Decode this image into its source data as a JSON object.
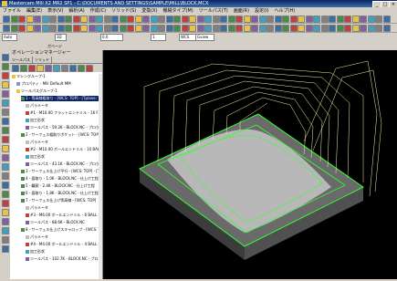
{
  "window": {
    "title": "Mastercam Mill X2 MR2 SP1 - C:\\DOCUMENTS AND SETTINGS\\SAMPLE\\MILL\\BLOCK.MCX"
  },
  "menu": [
    "ファイル",
    "編集(E)",
    "表示(V)",
    "解析(A)",
    "作成(C)",
    "ソリッド(S)",
    "変換(X)",
    "機械タイプ(M)",
    "ツールパス(T)",
    "画面(R)",
    "設定(I)",
    "ヘルプ(H)"
  ],
  "toolbar": {
    "zoom_value": "Auto",
    "plane_value": "3D",
    "z_value": "0.0",
    "level_value": "1",
    "wcs_label": "WCS",
    "grid_label": "Gview"
  },
  "ruler": {
    "label": "ガベージ"
  },
  "panel": {
    "title": "オペレーションマネージャー",
    "tabs": [
      "ツールパス",
      "ソリッド"
    ],
    "tree": [
      {
        "indent": 0,
        "text": "マシングループ-1",
        "icon": "folder"
      },
      {
        "indent": 1,
        "text": "プロパティ - Mill Default MM",
        "icon": "props"
      },
      {
        "indent": 1,
        "text": "ツールパスグループ-1",
        "icon": "folder"
      },
      {
        "indent": 2,
        "text": "1 - 等高線粗取り - [WCS: TOP] - [Tplane: TOP]",
        "icon": "op",
        "selected": true
      },
      {
        "indent": 3,
        "text": "パラメータ",
        "icon": "params"
      },
      {
        "indent": 3,
        "text": "#1 - M16.00 フラットエンドミル - 16 FLAT ENDMILL",
        "icon": "tool"
      },
      {
        "indent": 3,
        "text": "加工形状",
        "icon": "geom"
      },
      {
        "indent": 3,
        "text": "ツールパス - 59.2K - BLOCK.NC - プログラム番号 0",
        "icon": "path"
      },
      {
        "indent": 2,
        "text": "2 - サーフェス粗取りポケット - [WCS: TOP]",
        "icon": "op"
      },
      {
        "indent": 3,
        "text": "パラメータ",
        "icon": "params"
      },
      {
        "indent": 3,
        "text": "#2 - M10.00 ボールエンドミル - 10 BALL ENDMILL",
        "icon": "tool"
      },
      {
        "indent": 3,
        "text": "加工形状",
        "icon": "geom"
      },
      {
        "indent": 3,
        "text": "ツールパス - 43.1K - BLOCK.NC - プログラム番号 0",
        "icon": "path"
      },
      {
        "indent": 2,
        "text": "3 - サーフェス仕上げ平行 - [WCS: TOP] - [Tplane: TOP]",
        "icon": "op"
      },
      {
        "indent": 2,
        "text": "4 - 面取り - 1.0K - BLOCK.NC - 仕上げ工程",
        "icon": "op"
      },
      {
        "indent": 2,
        "text": "5 - 輪郭 - 2.4K - BLOCK.NC - 仕上げ工程",
        "icon": "op"
      },
      {
        "indent": 2,
        "text": "6 - 面取り - 1.8K - BLOCK.NC - 仕上げ工程",
        "icon": "op"
      },
      {
        "indent": 2,
        "text": "7 - サーフェス仕上げ等高線 - [WCS: TOP]",
        "icon": "op"
      },
      {
        "indent": 3,
        "text": "パラメータ",
        "icon": "params"
      },
      {
        "indent": 3,
        "text": "#3 - M6.00 ボールエンドミル - 6 BALL",
        "icon": "tool"
      },
      {
        "indent": 3,
        "text": "ツールパス - 88.6K - BLOCK.NC",
        "icon": "path"
      },
      {
        "indent": 2,
        "text": "8 - サーフェス仕上げスキャロップ - [WCS: TOP]",
        "icon": "op"
      },
      {
        "indent": 3,
        "text": "パラメータ",
        "icon": "params"
      },
      {
        "indent": 3,
        "text": "#4 - M4.00 ボールエンドミル - 4 BALL",
        "icon": "tool"
      },
      {
        "indent": 3,
        "text": "加工形状",
        "icon": "geom"
      },
      {
        "indent": 3,
        "text": "ツールパス - 102.7K - BLOCK.NC - プログラム番号 0",
        "icon": "path"
      }
    ]
  },
  "colors": {
    "titlebar": "#0a246a",
    "selection": "#0a246a",
    "viewport_bg": "#000000",
    "toolpath_green": "#33ff33",
    "toolpath_yellow": "#f5f0a0"
  }
}
